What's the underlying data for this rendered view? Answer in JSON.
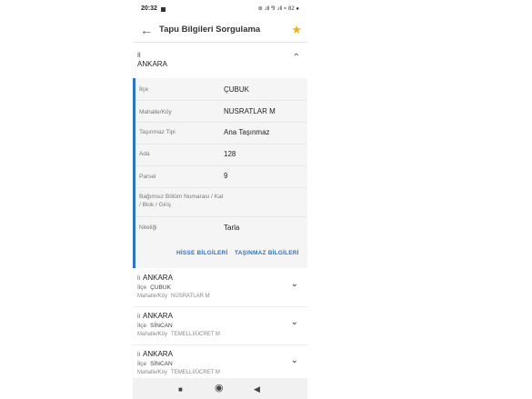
{
  "status": {
    "time": "20:32",
    "icons": "⊛ .ıll ⅋ .ıll ≈ 82 ●"
  },
  "app_bar": {
    "title": "Tapu Bilgileri Sorgulama",
    "back_icon": "←",
    "star_icon": "★"
  },
  "il_section": {
    "label": "İl",
    "value": "ANKARA",
    "chevron": "⌃"
  },
  "details": [
    {
      "label": "İlçe",
      "value": "ÇUBUK"
    },
    {
      "label": "Mahalle/Köy",
      "value": "NUSRATLAR M"
    },
    {
      "label": "Taşınmaz Tipi",
      "value": "Ana Taşınmaz"
    },
    {
      "label": "Ada",
      "value": "128"
    },
    {
      "label": "Parsel",
      "value": "9"
    },
    {
      "label": "Bağımsız Bölüm Numarası / Kat / Blok / Giriş",
      "value": ""
    },
    {
      "label": "Niteliği",
      "value": "Tarla"
    }
  ],
  "links": {
    "hisse": "HİSSE BİLGİLERİ",
    "tasinmaz": "TAŞINMAZ BİLGİLERİ"
  },
  "cards": [
    {
      "il_abbr": "İl",
      "il": "ANKARA",
      "ilce_label": "İlçe",
      "ilce": "ÇUBUK",
      "mah_label": "Mahalle/Köy",
      "mah": "NUSRATLAR M",
      "chevron": "⌄"
    },
    {
      "il_abbr": "İl",
      "il": "ANKARA",
      "ilce_label": "İlçe",
      "ilce": "SİNCAN",
      "mah_label": "Mahalle/Köy",
      "mah": "TEMELLİ/ÜCRET M",
      "chevron": "⌄"
    },
    {
      "il_abbr": "İl",
      "il": "ANKARA",
      "ilce_label": "İlçe",
      "ilce": "SİNCAN",
      "mah_label": "Mahalle/Köy",
      "mah": "TEMELLİ/ÜCRET M",
      "chevron": "⌄"
    }
  ],
  "nav": {
    "recents": "■",
    "home": "◉",
    "back": "◀"
  },
  "colors": {
    "accent": "#2f74c0",
    "star": "#f2b01e",
    "detail_bg": "#f5f5f5"
  }
}
